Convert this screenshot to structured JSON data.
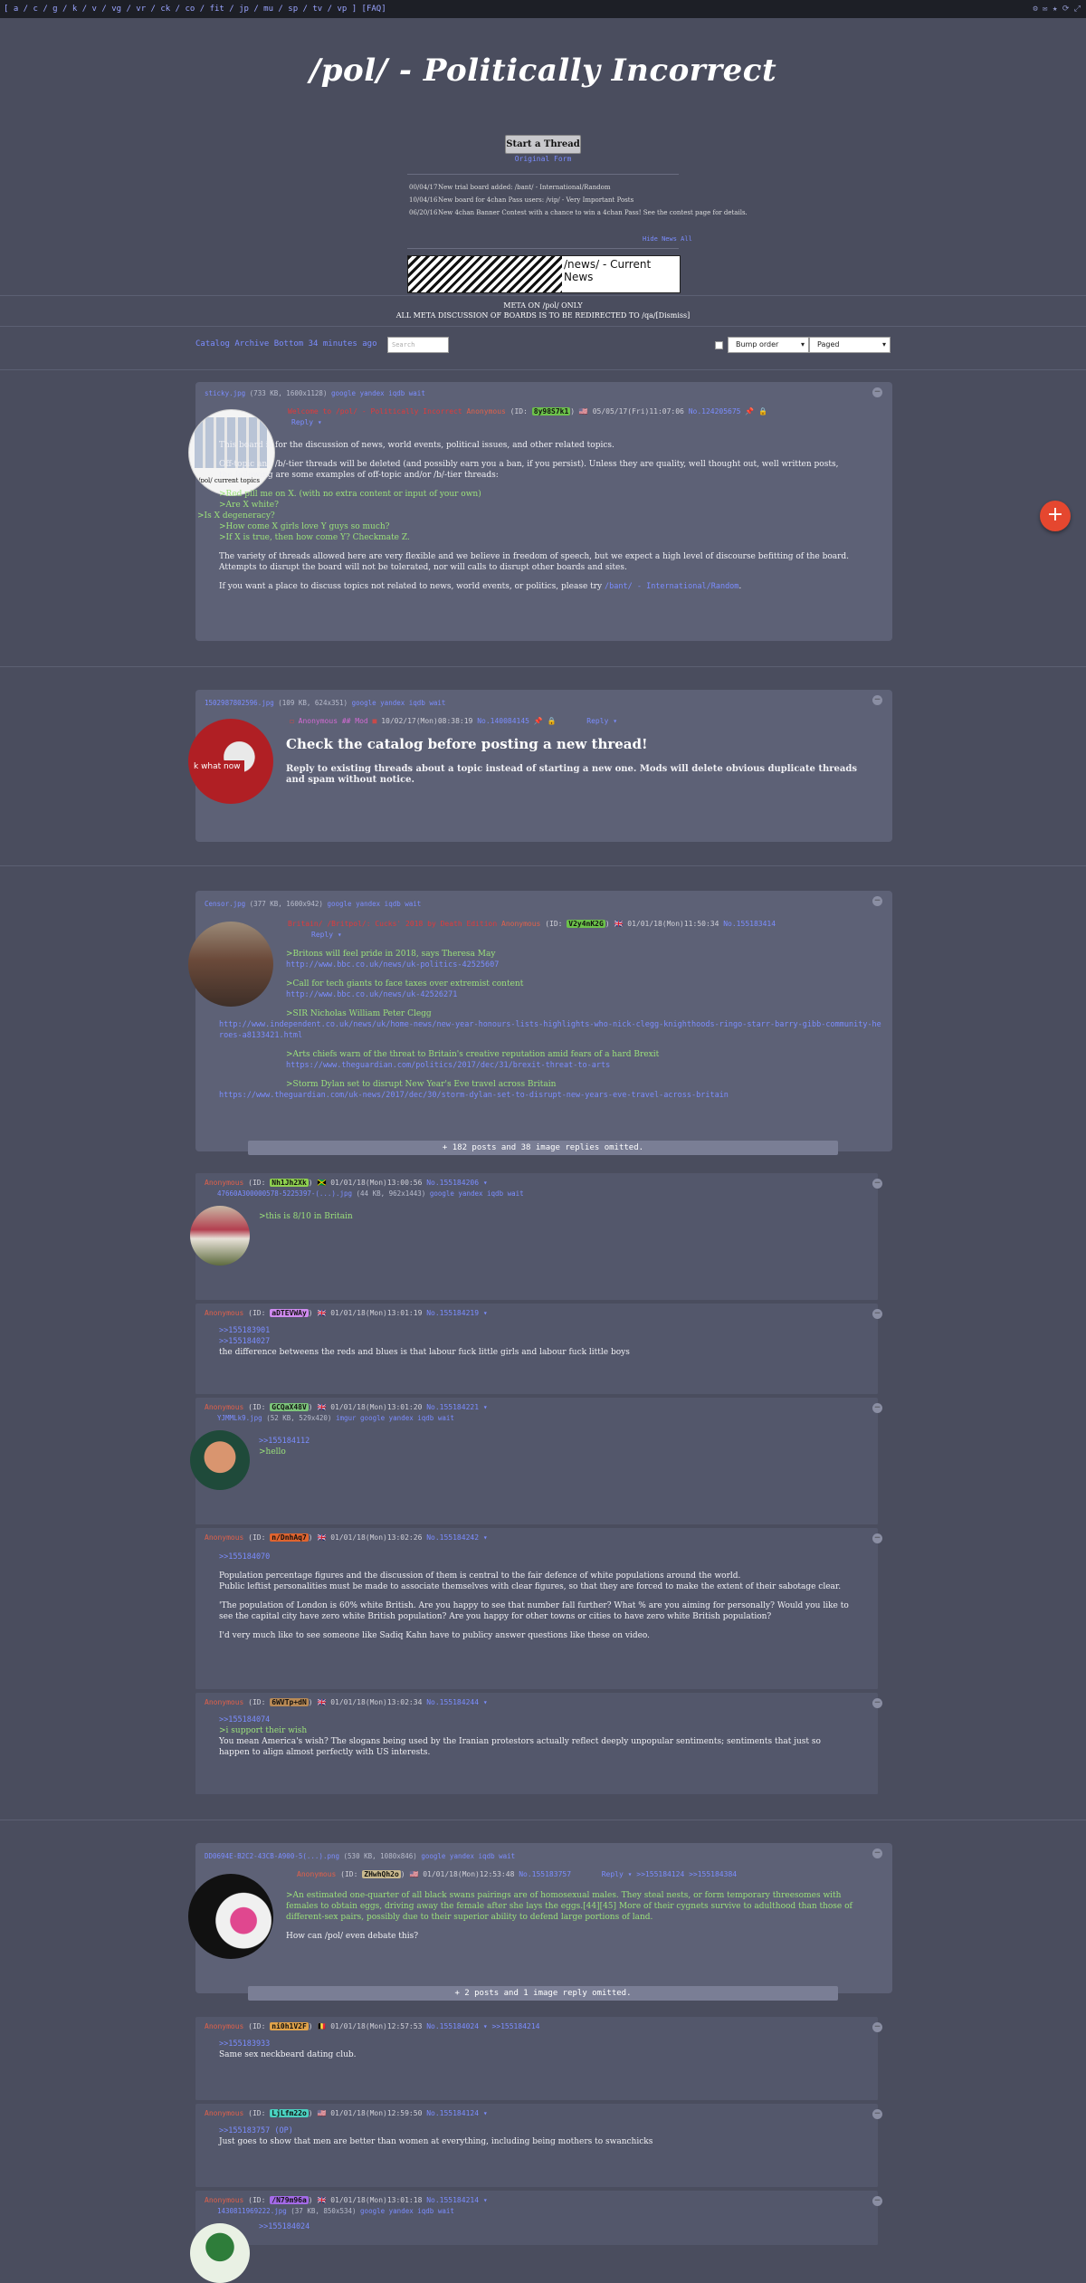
{
  "topbar": {
    "boards": "[ a / c / g / k / v / vg / vr / ck / co / fit / jp / mu / sp / tv / vp ] [FAQ]",
    "tools": "⚙ ✉ ★ ⟳ ⤢"
  },
  "board_title": "/pol/ - Politically Incorrect",
  "start_thread": "Start a Thread",
  "original_form": "Original Form",
  "news": [
    {
      "date": "00/04/17",
      "text": "New trial board added: /bant/ - International/Random"
    },
    {
      "date": "10/04/16",
      "text": "New board for 4chan Pass users: /vip/ - Very Important Posts"
    },
    {
      "date": "06/20/16",
      "text": "New 4chan Banner Contest with a chance to win a 4chan Pass! See the contest page for details."
    }
  ],
  "hide_all": "Hide News All",
  "banner_text": "/news/ - Current News",
  "meta_note_1": "META ON /pol/ ONLY",
  "meta_note_2": "ALL META DISCUSSION OF BOARDS IS TO BE REDIRECTED TO /qa/[Dismiss]",
  "controls": {
    "links": "Catalog  Archive  Bottom  34 minutes ago",
    "search_placeholder": "Search",
    "sort": "Bump order",
    "view": "Paged"
  },
  "threads": [
    {
      "file": "sticky.jpg",
      "file_meta": "(733 KB, 1600x1128)",
      "file_tools": "google yandex iqdb wait",
      "subject": "Welcome to /pol/ - Politically Incorrect",
      "name": "Anonymous",
      "id": "8y98S7k1",
      "id_color": "#6cc24a",
      "date": "05/05/17(Fri)11:07:06",
      "no": "No.124205675",
      "reply": "Reply",
      "thumb_label": "/pol/ current topics",
      "body": [
        "This board is for the discussion of news, world events, political issues, and other related topics.",
        "Off-topic and /b/-tier threads will be deleted (and possibly earn you a ban, if you persist). Unless they are quality, well thought out, well written posts, the following are some examples of off-topic and/or /b/-tier threads:",
        ">Red pill me on X. (with no extra content or input of your own)",
        ">Are X white?",
        ">Is X degeneracy?",
        ">How come X girls love Y guys so much?",
        ">If X is true, then how come Y? Checkmate Z.",
        "The variety of threads allowed here are very flexible and we believe in freedom of speech, but we expect a high level of discourse befitting of the board. Attempts to disrupt the board will not be tolerated, nor will calls to disrupt other boards and sites.",
        "If you want a place to discuss topics not related to news, world events, or politics, please try",
        "/bant/ - International/Random"
      ]
    },
    {
      "file": "1502987802596.jpg",
      "file_meta": "(109 KB, 624x351)",
      "file_tools": "google yandex iqdb wait",
      "name": "Anonymous ## Mod",
      "date": "10/02/17(Mon)08:38:19",
      "no": "No.140084145",
      "reply": "Reply",
      "thumb_label": "k what now",
      "headline": "Check the catalog before posting a new thread!",
      "body": "Reply to existing threads about a topic instead of starting a new one. Mods will delete obvious duplicate threads and spam without notice."
    },
    {
      "file": "Censor.jpg",
      "file_meta": "(377 KB, 1600x942)",
      "file_tools": "google yandex iqdb wait",
      "subject": "Britain/ /Britpol/: Cucks' 2018 by Death Edition",
      "name": "Anonymous",
      "id": "V2y4nK2G",
      "id_color": "#6cc24a",
      "date": "01/01/18(Mon)11:50:34",
      "no": "No.155183414",
      "reply": "Reply",
      "items": [
        {
          "q": ">Britons will feel pride in 2018, says Theresa May",
          "u": "http://www.bbc.co.uk/news/uk-politics-42525607"
        },
        {
          "q": ">Call for tech giants to face taxes over extremist content",
          "u": "http://www.bbc.co.uk/news/uk-42526271"
        },
        {
          "q": ">SIR Nicholas William Peter Clegg",
          "u": "http://www.independent.co.uk/news/uk/home-news/new-year-honours-lists-highlights-who-nick-clegg-knighthoods-ringo-starr-barry-gibb-community-heroes-a8133421.html"
        },
        {
          "q": ">Arts chiefs warn of the threat to Britain's creative reputation amid fears of a hard Brexit",
          "u": "https://www.theguardian.com/politics/2017/dec/31/brexit-threat-to-arts"
        },
        {
          "q": ">Storm Dylan set to disrupt New Year's Eve travel across Britain",
          "u": "https://www.theguardian.com/uk-news/2017/dec/30/storm-dylan-set-to-disrupt-new-years-eve-travel-across-britain"
        }
      ],
      "omitted": "+ 182 posts and 38 image replies omitted.",
      "replies": [
        {
          "name": "Anonymous",
          "id": "Nh1Jh2Xk",
          "id_color": "#8fd14f",
          "flag": "🇯🇲",
          "date": "01/01/18(Mon)13:00:56",
          "no": "No.155184206",
          "file": "47660A300000578-5225397-(...).jpg",
          "file_meta": "(44 KB, 962x1443)",
          "file_tools": "google yandex iqdb wait",
          "lines": [
            ">this is 8/10 in Britain"
          ]
        },
        {
          "name": "Anonymous",
          "id": "aDTEVWAy",
          "id_color": "#d08bf0",
          "flag": "🇬🇧",
          "date": "01/01/18(Mon)13:01:19",
          "no": "No.155184219",
          "lines": [
            ">>155183901",
            ">>155184027",
            "the difference betweens the reds and blues is that labour fuck little girls and labour fuck little boys"
          ]
        },
        {
          "name": "Anonymous",
          "id": "GCQaX48V",
          "id_color": "#7cc47a",
          "flag": "🇬🇧",
          "date": "01/01/18(Mon)13:01:20",
          "no": "No.155184221",
          "file": "YJMMLk9.jpg",
          "file_meta": "(52 KB, 529x420)",
          "file_tools": "imgur google yandex iqdb wait",
          "lines": [
            ">>155184112",
            ">hello"
          ]
        },
        {
          "name": "Anonymous",
          "id": "n/DnhAq7",
          "id_color": "#e0642f",
          "flag": "🇬🇧",
          "date": "01/01/18(Mon)13:02:26",
          "no": "No.155184242",
          "lines": [
            ">>155184070",
            "Population percentage figures and the discussion of them is central to the fair defence of white populations around the world.",
            "Public leftist personalities must be made to associate themselves with clear figures, so that they are forced to make the extent of their sabotage clear.",
            "'The population of London is 60% white British. Are you happy to see that number fall further? What % are you aiming for personally? Would you like to see the capital city have zero white British population? Are you happy for other towns or cities to have zero white British population?",
            "I'd very much like to see someone like Sadiq Kahn have to publicy answer questions like these on video."
          ]
        },
        {
          "name": "Anonymous",
          "id": "6WVTp+dN",
          "id_color": "#b98a55",
          "flag": "🇬🇧",
          "date": "01/01/18(Mon)13:02:34",
          "no": "No.155184244",
          "lines": [
            ">>155184074",
            ">i support their wish",
            "You mean America's wish? The slogans being used by the Iranian protestors actually reflect deeply unpopular sentiments; sentiments that just so happen to align almost perfectly with US interests."
          ]
        }
      ]
    },
    {
      "file": "DD0694E-B2C2-43CB-A900-5(...).png",
      "file_meta": "(530 KB, 1080x846)",
      "file_tools": "google yandex iqdb wait",
      "name": "Anonymous",
      "id": "ZHwhQh2o",
      "id_color": "#c9b98e",
      "date": "01/01/18(Mon)12:53:48",
      "no": "No.155183757",
      "reply": "Reply",
      "backlinks": ">>155184124 >>155184384",
      "body": [
        ">An estimated one-quarter of all black swans pairings are of homosexual males. They steal nests, or form temporary threesomes with females to obtain eggs, driving away the female after she lays the eggs.[44][45] More of their cygnets survive to adulthood than those of different-sex pairs, possibly due to their superior ability to defend large portions of land.",
        "How can /pol/ even debate this?"
      ],
      "omitted": "+ 2 posts and 1 image reply omitted.",
      "replies": [
        {
          "name": "Anonymous",
          "id": "ni0h1V2F",
          "id_color": "#e0a24a",
          "flag": "🇧🇪",
          "date": "01/01/18(Mon)12:57:53",
          "no": "No.155184024",
          "lines": [
            ">>155183933",
            "Same sex neckbeard dating club."
          ]
        },
        {
          "name": "Anonymous",
          "id": "LjLfm22o",
          "id_color": "#4ad1c0",
          "flag": "🇺🇸",
          "date": "01/01/18(Mon)12:59:50",
          "no": "No.155184124",
          "lines": [
            ">>155183757 (OP)",
            "Just goes to show that men are better than women at everything, including being mothers to swanchicks"
          ]
        },
        {
          "name": "Anonymous",
          "id": "/N79m96a",
          "id_color": "#a46ae8",
          "flag": "🇬🇧",
          "date": "01/01/18(Mon)13:01:18",
          "no": "No.155184214",
          "file": "1430811969222.jpg",
          "file_meta": "(37 KB, 850x534)",
          "file_tools": "google yandex iqdb wait",
          "lines": [
            ">>155184024"
          ]
        }
      ]
    }
  ],
  "fab_label": "+"
}
